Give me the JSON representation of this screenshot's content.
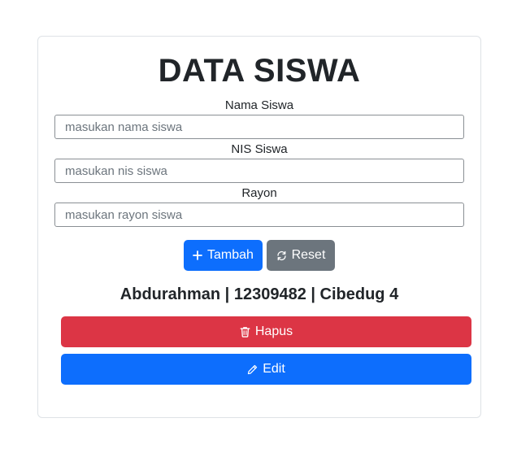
{
  "header": {
    "title": "DATA SISWA"
  },
  "form": {
    "nama": {
      "label": "Nama Siswa",
      "placeholder": "masukan nama siswa",
      "value": ""
    },
    "nis": {
      "label": "NIS Siswa",
      "placeholder": "masukan nis siswa",
      "value": ""
    },
    "rayon": {
      "label": "Rayon",
      "placeholder": "masukan rayon siswa",
      "value": ""
    }
  },
  "actions": {
    "tambah_label": "Tambah",
    "reset_label": "Reset"
  },
  "student": {
    "display": "Abdurahman | 12309482 | Cibedug 4",
    "hapus_label": "Hapus",
    "edit_label": "Edit"
  },
  "colors": {
    "primary": "#0d6efd",
    "secondary": "#6c757d",
    "danger": "#dc3545"
  },
  "icons": {
    "tambah": "plus-icon",
    "reset": "refresh-icon",
    "hapus": "trash-icon",
    "edit": "pencil-icon"
  }
}
